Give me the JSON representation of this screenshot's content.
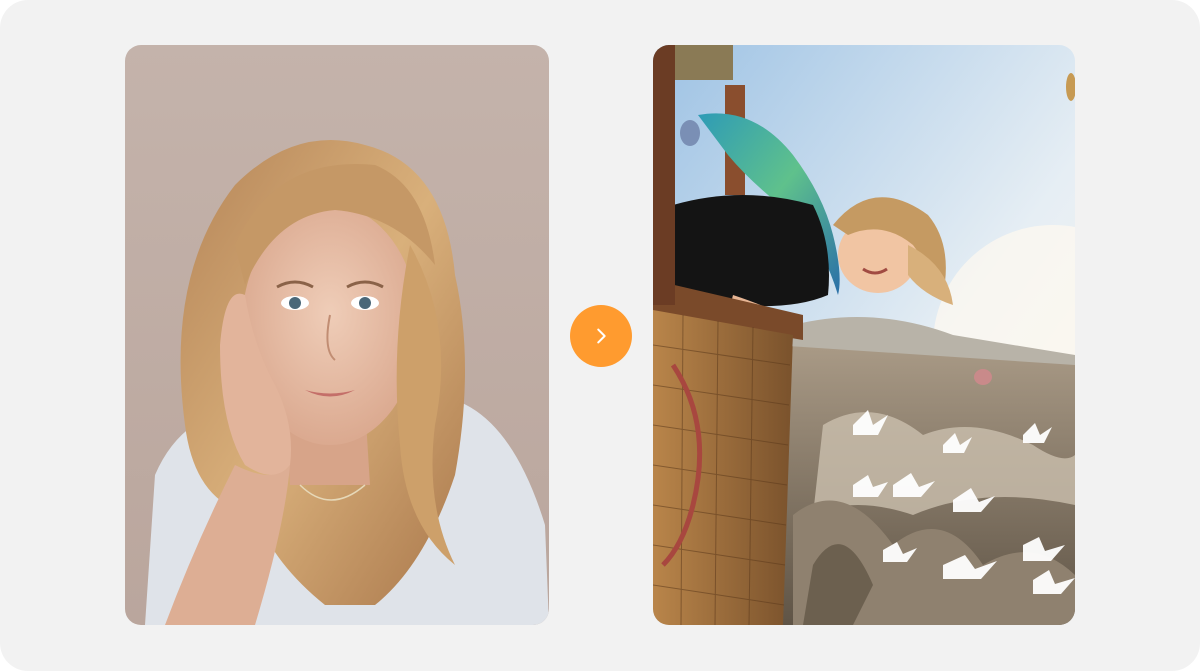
{
  "before_image": {
    "description_icon": "portrait-photo",
    "background_color": "#c8b7ae"
  },
  "after_image": {
    "description_icon": "hot-air-balloon-photo",
    "sky_color": "#cfe0ef"
  },
  "arrow_button": {
    "icon": "chevron-right-icon",
    "color": "#ff9b2f"
  },
  "colors": {
    "card_background": "#f2f2f2",
    "accent": "#ff9b2f"
  }
}
